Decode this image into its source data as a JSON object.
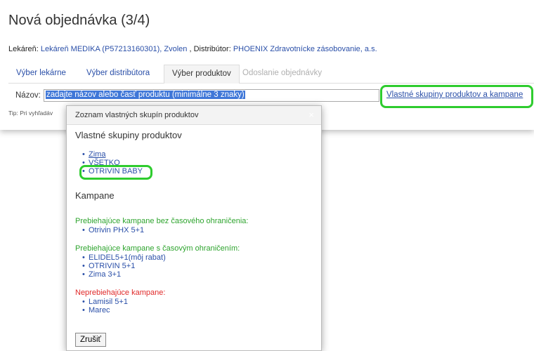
{
  "page": {
    "title": "Nová objednávka (3/4)",
    "pharmacy_label": "Lekáreň:",
    "pharmacy_value": "Lekáreň MEDIKA (P57213160301), Zvolen",
    "separator": " , ",
    "distributor_label": "Distribútor:",
    "distributor_value": "PHOENIX Zdravotnícke zásobovanie, a.s."
  },
  "tabs": [
    {
      "label": "Výber lekárne",
      "state": "link"
    },
    {
      "label": "Výber distribútora",
      "state": "link"
    },
    {
      "label": "Výber produktov",
      "state": "active"
    },
    {
      "label": "Odoslanie objednávky",
      "state": "disabled"
    }
  ],
  "search": {
    "label": "Názov:",
    "value": "zadajte názov alebo časť produktu (minimálne 3 znaky)",
    "groups_link": "Vlastné skupiny produktov a kampane",
    "tip": "Tip: Pri vyhľadáv"
  },
  "modal": {
    "title": "Zoznam vlastných skupín produktov",
    "close_glyph": "×",
    "groups_heading": "Vlastné skupiny produktov",
    "groups": [
      "Zima",
      "VŠETKO",
      "OTRIVIN BABY"
    ],
    "campaigns_heading": "Kampane",
    "ongoing_unlimited_label": "Prebiehajúce kampane bez časového ohraničenia:",
    "ongoing_unlimited": [
      "Otrivin PHX 5+1"
    ],
    "ongoing_limited_label": "Prebiehajúce kampane s časovým ohraničením:",
    "ongoing_limited": [
      "ELIDEL5+1(môj rabat)",
      "OTRIVIN 5+1",
      "Zima 3+1"
    ],
    "not_running_label": "Neprebiehajúce kampane:",
    "not_running": [
      "Lamisil 5+1",
      "Marec"
    ],
    "cancel_label": "Zrušiť"
  },
  "colors": {
    "link": "#2a4fa8",
    "highlight": "#2ecc2e",
    "ongoing": "#2ea42e",
    "not_running": "#e02a2a",
    "selection": "#3f77d8"
  }
}
